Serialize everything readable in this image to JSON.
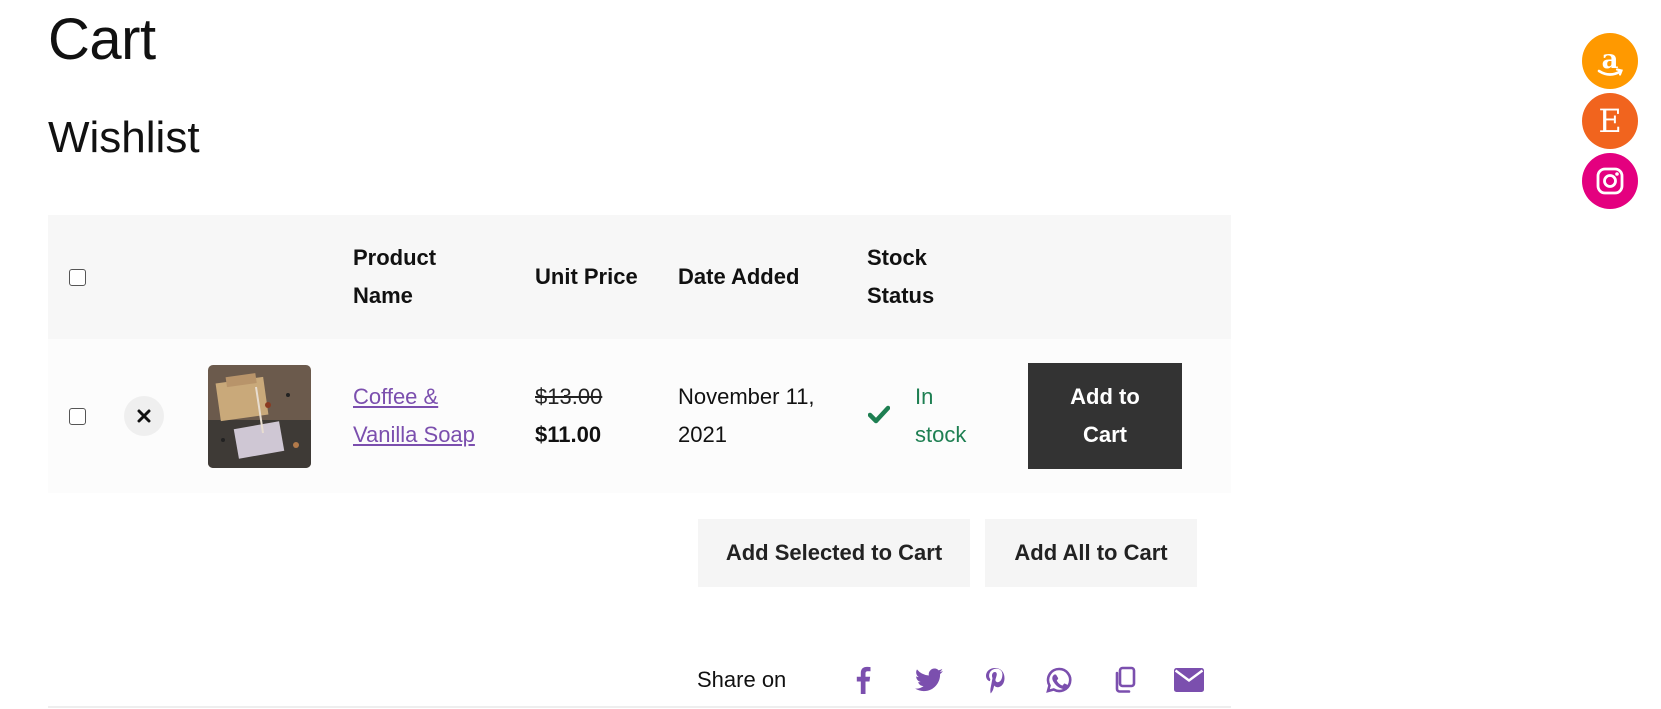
{
  "page": {
    "title": "Cart",
    "section_title": "Wishlist"
  },
  "table": {
    "headers": {
      "product_name": [
        "Product",
        "Name"
      ],
      "unit_price": "Unit Price",
      "date_added": "Date Added",
      "stock_status": [
        "Stock",
        "Status"
      ]
    },
    "rows": [
      {
        "product_name": [
          "Coffee &",
          "Vanilla Soap"
        ],
        "old_price": "$13.00",
        "price": "$11.00",
        "date_added": [
          "November 11,",
          "2021"
        ],
        "stock": [
          "In",
          "stock"
        ],
        "add_to_cart": [
          "Add to",
          "Cart"
        ]
      }
    ]
  },
  "actions": {
    "add_selected": "Add Selected to Cart",
    "add_all": "Add All to Cart"
  },
  "share": {
    "label": "Share on",
    "icons": [
      "facebook-icon",
      "twitter-icon",
      "pinterest-icon",
      "whatsapp-icon",
      "copy-icon",
      "email-icon"
    ]
  },
  "floating_links": [
    {
      "name": "amazon-icon",
      "color": "#ff9900"
    },
    {
      "name": "etsy-icon",
      "color": "#f1641e"
    },
    {
      "name": "instagram-icon",
      "color": "#e4007f"
    }
  ],
  "colors": {
    "link": "#7b4fae",
    "stock": "#1e7f52",
    "button_dark": "#333333",
    "share_icons": "#7b4fae"
  }
}
